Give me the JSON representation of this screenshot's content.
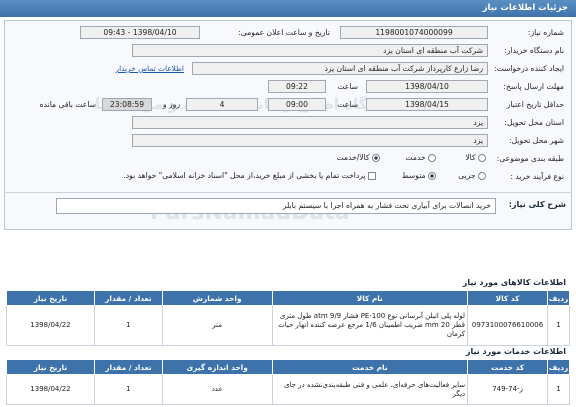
{
  "header": {
    "title": "جزئیات اطلاعات نیاز"
  },
  "fields": {
    "need_number": {
      "label": "شماره نیاز:",
      "value": "1198001074000099"
    },
    "announce_datetime": {
      "label": "تاریخ و ساعت اعلان عمومی:",
      "value": "1398/04/10 - 09:43"
    },
    "buyer_org": {
      "label": "نام دستگاه خریدار:",
      "value": "شرکت آب منطقه ای استان یزد"
    },
    "requester": {
      "label": "ایجاد کننده درخواست:",
      "value": "رضا زارع کارپرداز شرکت آب منطقه ای استان یزد",
      "contact_link": "اطلاعات تماس خریدار"
    },
    "reply_deadline": {
      "label": "مهلت ارسال پاسخ:",
      "date": "1398/04/10",
      "time_label": "ساعت",
      "time": "09:22"
    },
    "validity_deadline": {
      "label": "حداقل تاریخ اعتبار",
      "date": "1398/04/15",
      "time_label": "ساعت",
      "time": "09:00",
      "days": "4",
      "days_label": "روز و",
      "remaining_time": "23:08:59",
      "remaining_label": "ساعت باقی مانده"
    },
    "delivery_province": {
      "label": "استان محل تحویل:",
      "value": "یزد"
    },
    "delivery_city": {
      "label": "شهر محل تحویل:",
      "value": "یزد"
    },
    "category": {
      "label": "طبقه بندی موضوعی:",
      "options": [
        "کالا",
        "خدمت",
        "کالا/خدمت"
      ],
      "selected": "کالا/خدمت"
    },
    "purchase_process": {
      "label": "نوع فرآیند خرید :",
      "options": [
        "جزیی",
        "متوسط"
      ],
      "selected": "متوسط",
      "payment_note": "پرداخت تمام یا بخشی از مبلغ خرید،از محل \"اسناد خزانه اسلامی\" خواهد بود."
    }
  },
  "description": {
    "label": "شرح کلی نیاز:",
    "value": "خرید اتصالات برای آبیاری تحت فشار به همراه اجرا با سیستم بابلر"
  },
  "goods_section": {
    "title": "اطلاعات کالاهای مورد نیاز",
    "columns": [
      "ردیف",
      "کد کالا",
      "نام کالا",
      "واحد شمارش",
      "تعداد / مقدار",
      "تاریخ نیاز"
    ],
    "rows": [
      {
        "row": "1",
        "code": "0973100076610006",
        "name": "لوله پلی اتیلن آبرسانی نوع PE-100 فشار 9/9 atm طول متری قطر 20 mm ضریب اطمینان 1/6 مرجع عرضه کننده انهار حیات کرمان",
        "unit": "متر",
        "qty": "1",
        "date": "1398/04/22"
      }
    ]
  },
  "services_section": {
    "title": "اطلاعات خدمات مورد نیاز",
    "columns": [
      "ردیف",
      "کد خدمت",
      "نام خدمت",
      "واحد اندازه گیری",
      "تعداد / مقدار",
      "تاریخ نیاز"
    ],
    "rows": [
      {
        "row": "1",
        "code": "ز-74-749",
        "name": "سایر فعالیت‌های حرفه‌ای، علمی و فنی طبقه‌بندی‌نشده در جای دیگر",
        "unit": "عدد",
        "qty": "1",
        "date": "1398/04/22"
      }
    ]
  },
  "watermarks": [
    "ParsNamadData",
    "پایگاه اطلاع رسانی مناقصه و مزایده ها"
  ],
  "colors": {
    "header": "#3f73aa",
    "table_header": "#3d72aa",
    "link": "#1a55b0"
  }
}
